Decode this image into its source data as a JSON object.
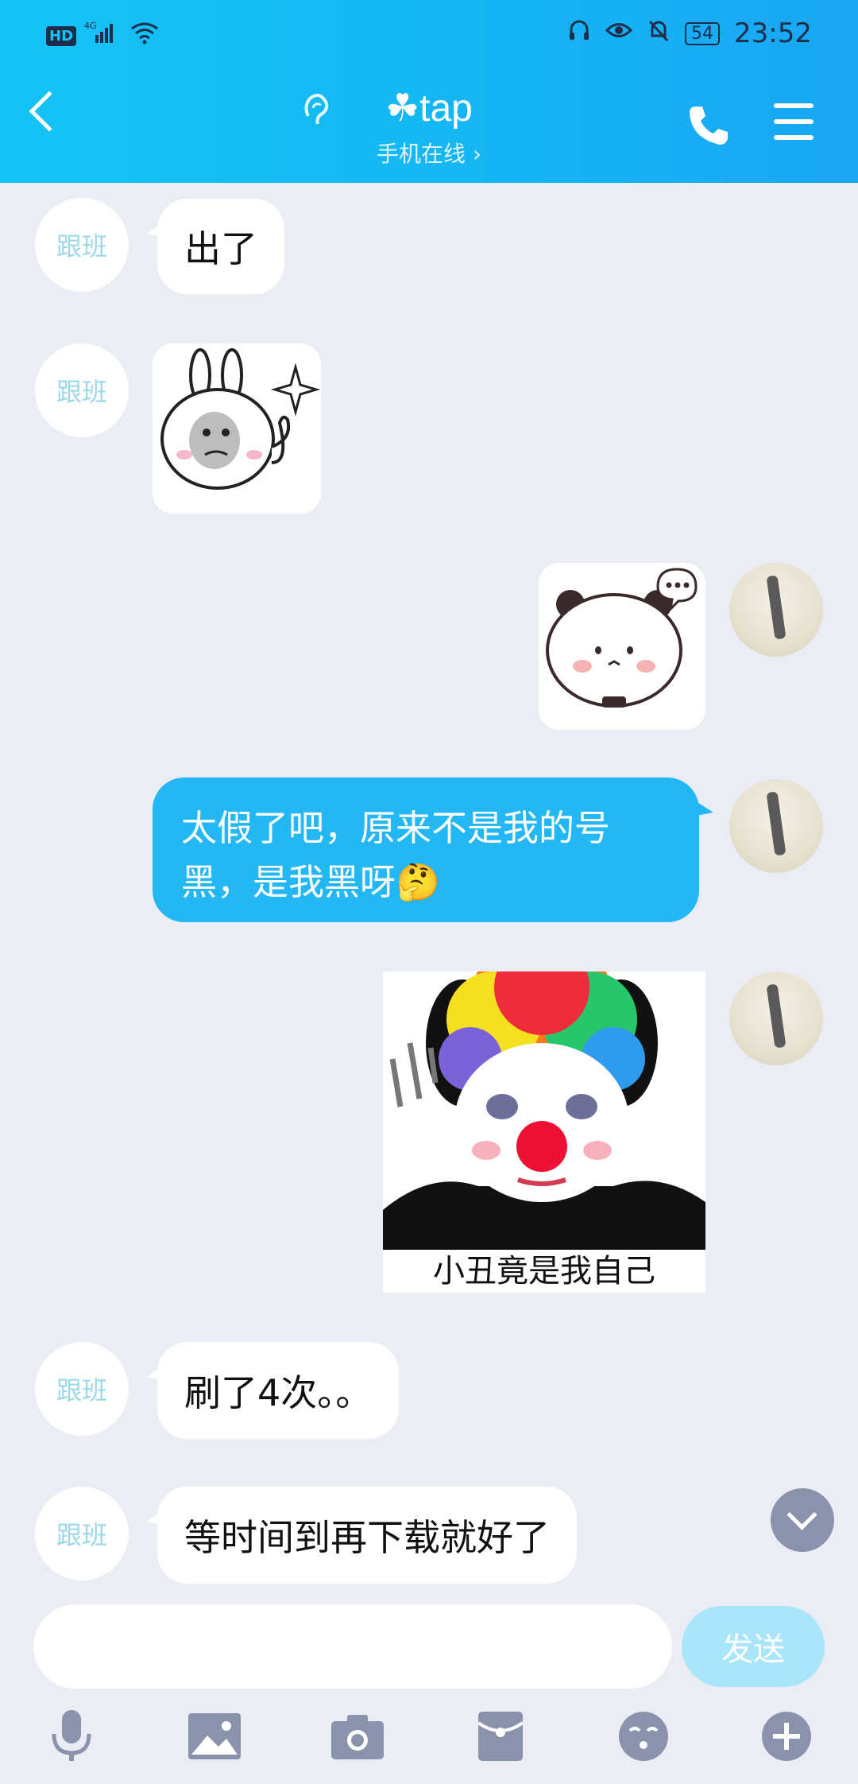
{
  "status_bar": {
    "time": "23:52",
    "battery": "54",
    "network": "4G",
    "hd": "HD"
  },
  "header": {
    "title": "☘tap",
    "subtitle": "手机在线 ›"
  },
  "messages": [
    {
      "side": "left",
      "avatar_text": "跟班",
      "text": "出了"
    },
    {
      "side": "left",
      "avatar_text": "跟班",
      "sticker": "bunny-thumbs-up"
    },
    {
      "side": "right",
      "sticker": "panda-thinking"
    },
    {
      "side": "right",
      "text": "太假了吧，原来不是我的号黑，是我黑呀🤔"
    },
    {
      "side": "right",
      "sticker": "clown-panda",
      "caption": "小丑竟是我自己"
    },
    {
      "side": "left",
      "avatar_text": "跟班",
      "text": "刷了4次。。"
    },
    {
      "side": "left",
      "avatar_text": "跟班",
      "text": "等时间到再下载就好了"
    }
  ],
  "input": {
    "value": "",
    "placeholder": ""
  },
  "send_label": "发送",
  "toolbar_icons": [
    "mic-icon",
    "image-icon",
    "camera-icon",
    "red-packet-icon",
    "emoji-icon",
    "plus-icon"
  ],
  "colors": {
    "header": "#14b6f4",
    "bubble_right": "#24b7f5",
    "background": "#eaedf4",
    "send_disabled": "#a9e6fb"
  }
}
